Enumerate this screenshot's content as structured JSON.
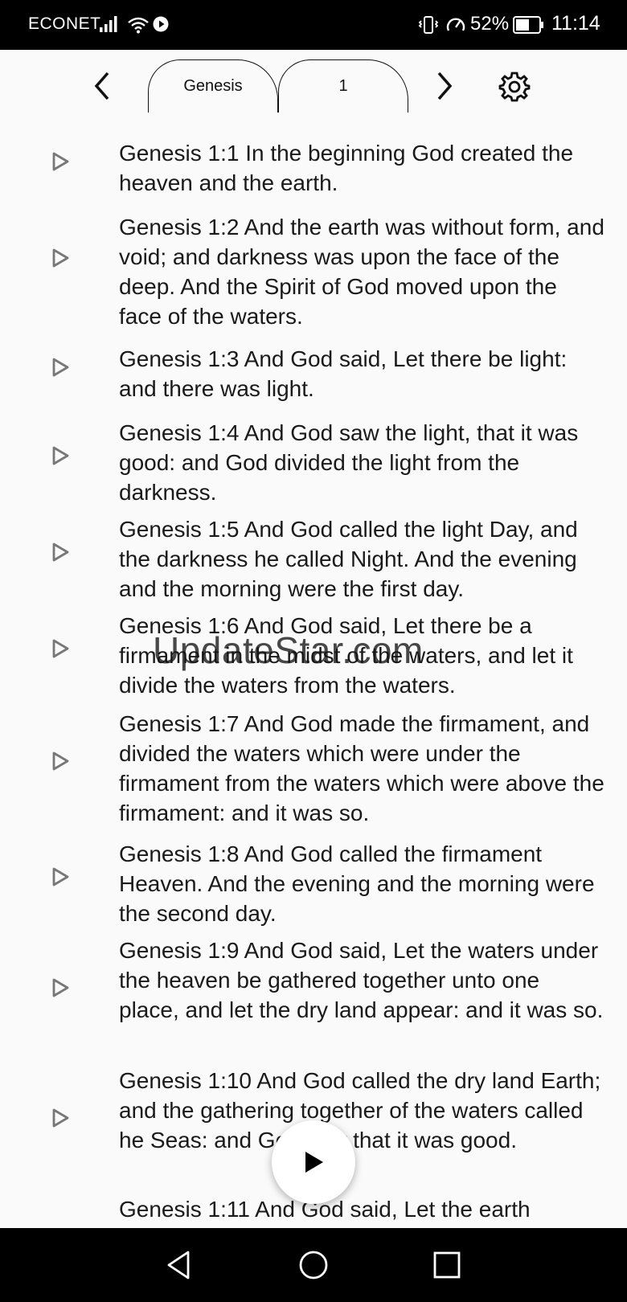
{
  "status": {
    "carrier": "ECONET",
    "battery_pct": "52%",
    "time": "11:14"
  },
  "topnav": {
    "book": "Genesis",
    "chapter": "1",
    "icons": [
      "chevron-left-icon",
      "chevron-right-icon",
      "gear-icon"
    ]
  },
  "verses": [
    {
      "text": "Genesis 1:1 In the beginning God created the heaven and the earth."
    },
    {
      "text": "Genesis 1:2 And the earth was without form, and void; and darkness was upon the face of the deep. And the Spirit of God moved upon the face of the waters."
    },
    {
      "text": "Genesis 1:3 And God said, Let there be light: and there was light."
    },
    {
      "text": "Genesis 1:4 And God saw the light, that it was good: and God divided the light from the darkness."
    },
    {
      "text": "Genesis 1:5 And God called the light Day, and the darkness he called Night. And the evening and the morning were the first day."
    },
    {
      "text": "Genesis 1:6 And God said, Let there be a firmament in the midst of the waters, and let it divide the waters from the waters."
    },
    {
      "text": "Genesis 1:7 And God made the firmament, and divided the waters which were under the firmament from the waters which were above the firmament: and it was so."
    },
    {
      "text": "Genesis 1:8 And God called the firmament Heaven. And the evening and the morning were the second day."
    },
    {
      "text": "Genesis 1:9 And God said, Let the waters under the heaven be gathered together unto one place, and let the dry land appear: and it was so."
    },
    {
      "text": "Genesis 1:10 And God called the dry land Earth; and the gathering together of the waters called he Seas: and God saw that it was good."
    },
    {
      "text": "Genesis 1:11 And God said, Let the earth"
    }
  ],
  "watermark": "UpdateStar.com",
  "colors": {
    "text": "#1a1a1a",
    "icon_gray": "#777777",
    "background": "#fafafa"
  }
}
